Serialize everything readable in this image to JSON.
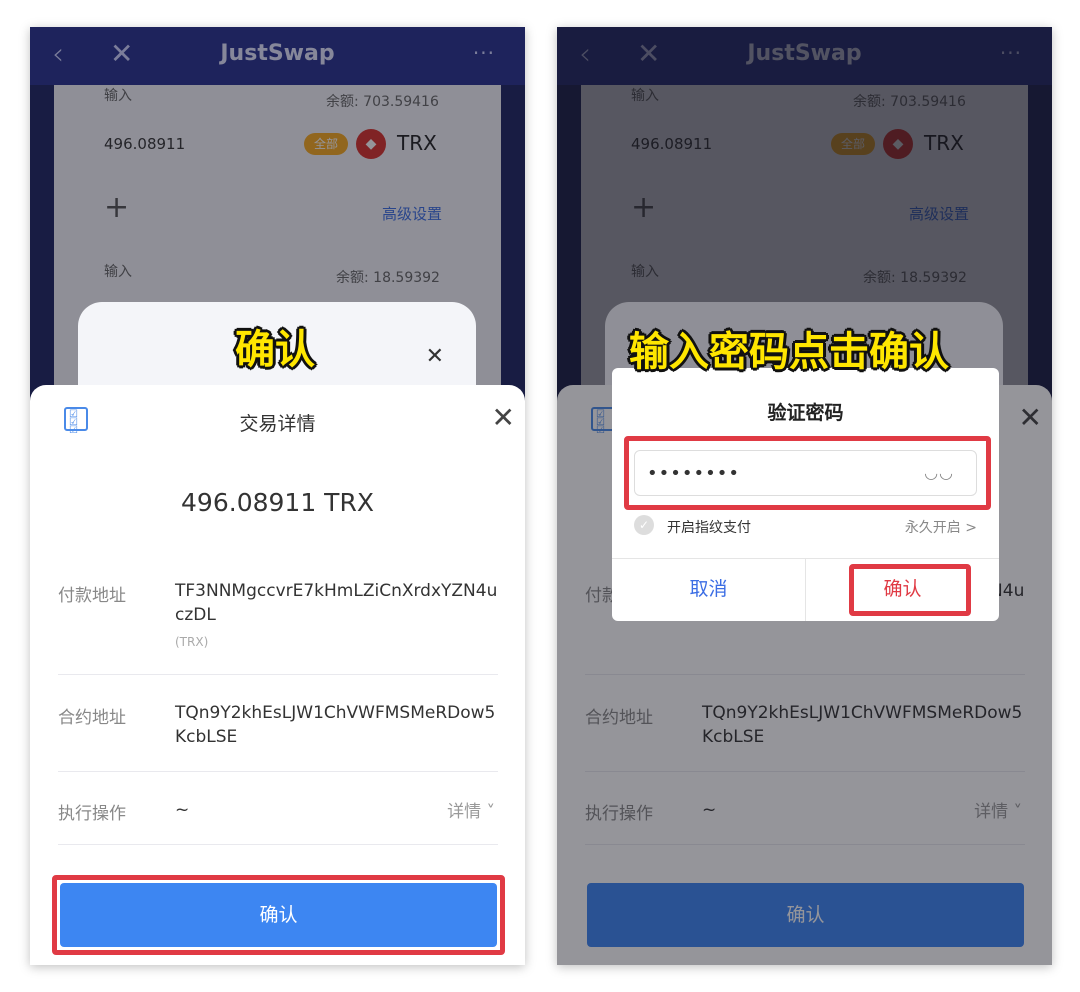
{
  "app": {
    "title": "JustSwap",
    "back_icon": "‹",
    "close_icon": "✕",
    "more_icon": "···"
  },
  "background": {
    "input_label_1": "输入",
    "balance_1": "余额: 703.59416",
    "amount_1": "496.08911",
    "max_pill": "全部",
    "token_name": "TRX",
    "add_icon": "+",
    "advanced_settings": "高级设置",
    "input_label_2": "输入",
    "balance_2": "余额: 18.59392"
  },
  "captions": {
    "left": "确认",
    "right": "输入密码点击确认"
  },
  "sheet": {
    "title": "交易详情",
    "amount": "496.08911 TRX",
    "payment_label": "付款地址",
    "payment_value": "TF3NNMgccvrE7kHmLZiCnXrdxYZN4uczDL",
    "payment_sub": "(TRX)",
    "contract_label": "合约地址",
    "contract_value": "TQn9Y2khEsLJW1ChVWFMSMeRDow5KcbLSE",
    "operation_label": "执行操作",
    "operation_value": "~",
    "details_link": "详情 ˅",
    "confirm_label": "确认"
  },
  "password_dialog": {
    "title": "验证密码",
    "password_value": "••••••••",
    "fingerprint_label": "开启指纹支付",
    "fingerprint_link": "永久开启 >",
    "cancel_label": "取消",
    "confirm_label": "确认"
  },
  "colors": {
    "header": "#27318f",
    "confirm_blue": "#3d86f2",
    "highlight_red": "#e03a44",
    "caption_yellow": "#ffe600"
  }
}
